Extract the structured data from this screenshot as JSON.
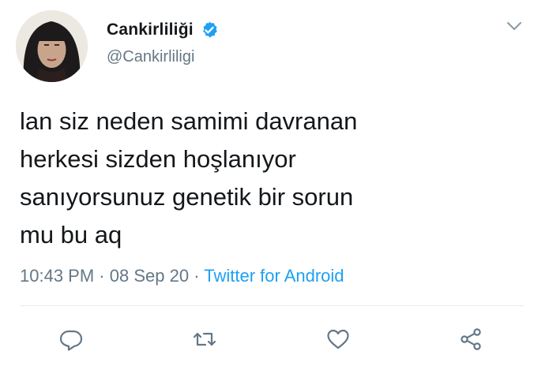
{
  "user": {
    "display_name": "Cankirliliği",
    "handle": "@Cankirliligi",
    "verified": true,
    "avatar_icon": "profile-photo"
  },
  "tweet": {
    "lines": [
      "lan siz neden samimi davranan",
      "herkesi sizden hoşlanıyor",
      "sanıyorsunuz genetik bir sorun",
      "mu bu aq"
    ],
    "time": "10:43 PM",
    "separator": "·",
    "date": "08 Sep 20",
    "source": "Twitter for Android"
  },
  "actions": {
    "icons": [
      "reply-icon",
      "retweet-icon",
      "like-icon",
      "share-icon"
    ]
  },
  "colors": {
    "text": "#14171a",
    "secondary": "#657786",
    "accent": "#1da1f2",
    "divider": "#e6ecf0"
  }
}
